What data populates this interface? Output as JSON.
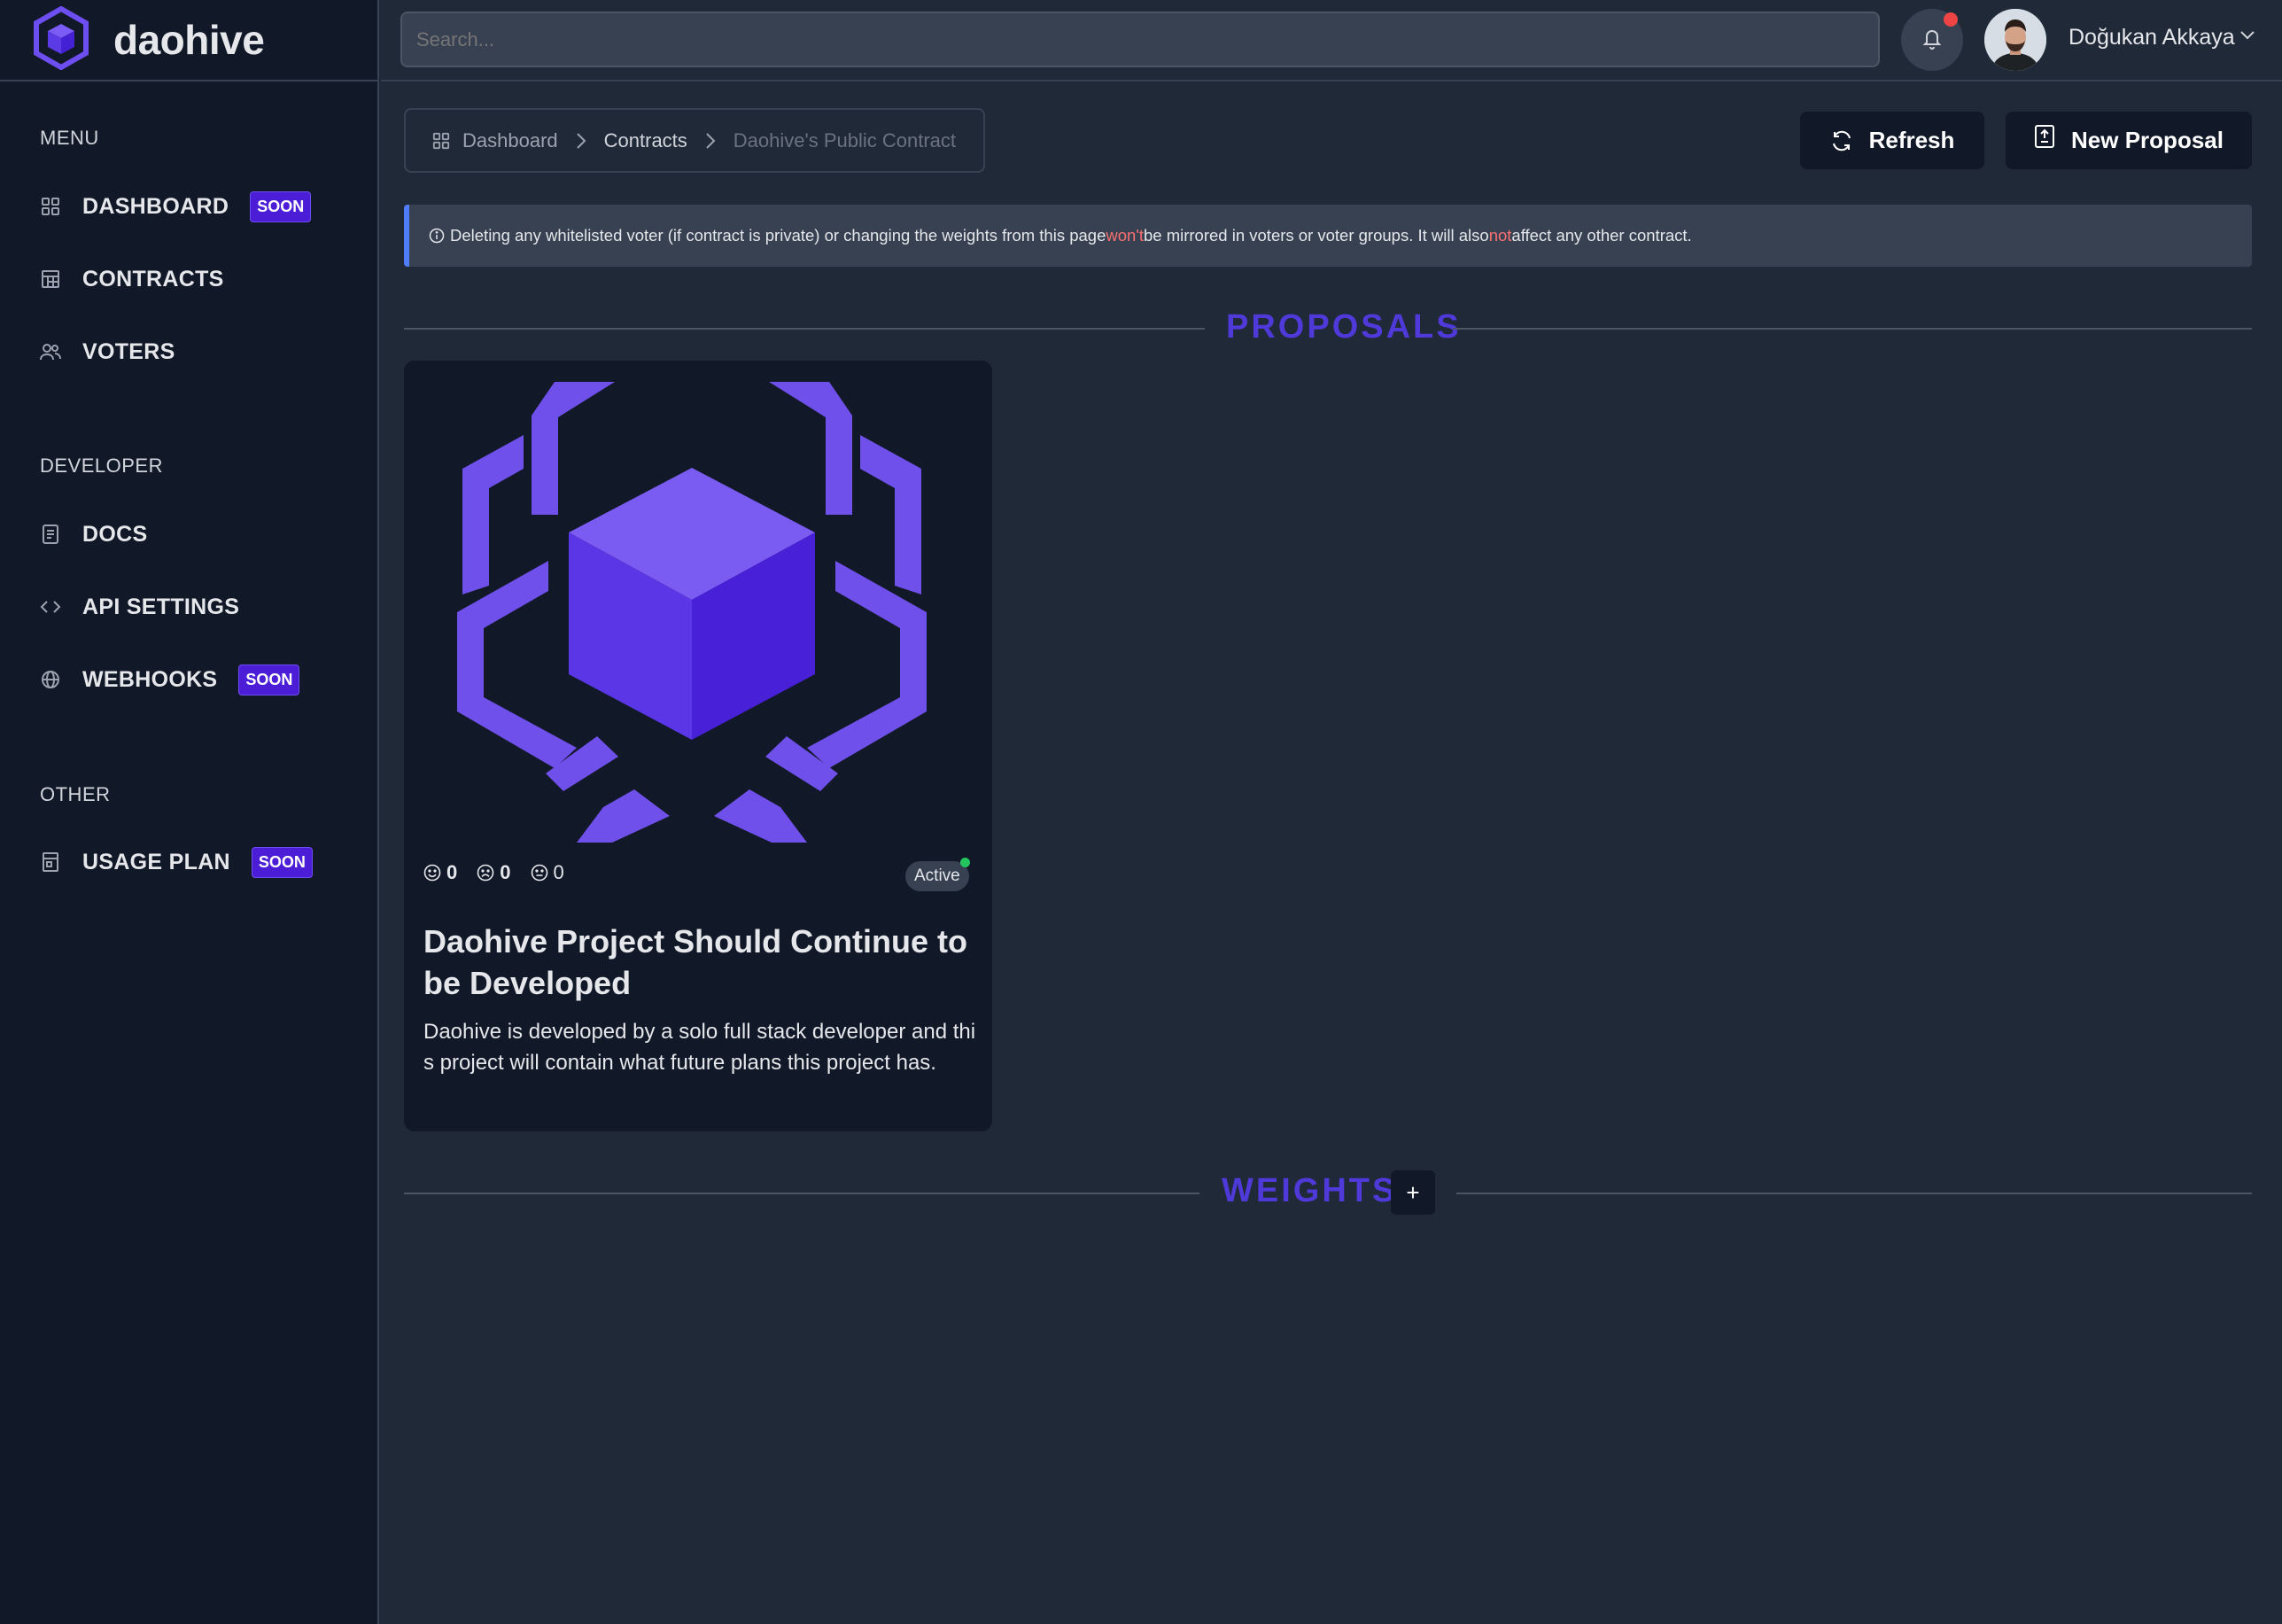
{
  "brand": {
    "name": "daohive"
  },
  "sidebar": {
    "sections": [
      {
        "title": "MENU"
      },
      {
        "title": "DEVELOPER"
      },
      {
        "title": "OTHER"
      }
    ],
    "items": [
      {
        "label": "DASHBOARD",
        "icon": "grid-icon",
        "badge": "SOON"
      },
      {
        "label": "CONTRACTS",
        "icon": "table-icon"
      },
      {
        "label": "VOTERS",
        "icon": "users-icon"
      },
      {
        "label": "DOCS",
        "icon": "document-icon"
      },
      {
        "label": "API SETTINGS",
        "icon": "code-icon"
      },
      {
        "label": "WEBHOOKS",
        "icon": "globe-icon",
        "badge": "SOON"
      },
      {
        "label": "USAGE PLAN",
        "icon": "receipt-icon",
        "badge": "SOON"
      }
    ]
  },
  "topbar": {
    "search_placeholder": "Search...",
    "user_name": "Doğukan Akkaya",
    "notification_indicator": "#ef4444"
  },
  "breadcrumb": [
    {
      "label": "Dashboard"
    },
    {
      "label": "Contracts"
    },
    {
      "label": "Daohive's Public Contract"
    }
  ],
  "actions": {
    "refresh_label": "Refresh",
    "new_proposal_label": "New Proposal"
  },
  "alert": {
    "part1": "Deleting any whitelisted voter (if contract is private) or changing the weights from this page ",
    "highlight1": "won't",
    "part2": " be mirrored in voters or voter groups. It will also ",
    "highlight2": "not",
    "part3": " affect any other contract."
  },
  "sections": {
    "proposals": "PROPOSALS",
    "weights": "WEIGHTS",
    "add_weight": "+"
  },
  "proposals": [
    {
      "title": "Daohive Project Should Continue to be Developed",
      "description": "Daohive is developed by a solo full stack developer and this project will contain what future plans this project has.",
      "status": "Active",
      "votes_for": "0",
      "votes_against": "0",
      "votes_abstain": "0"
    }
  ],
  "colors": {
    "accent": "#4f39d9",
    "badge": "#4c1dd6",
    "status_active": "#22c55e",
    "alert_highlight": "#f87171"
  }
}
